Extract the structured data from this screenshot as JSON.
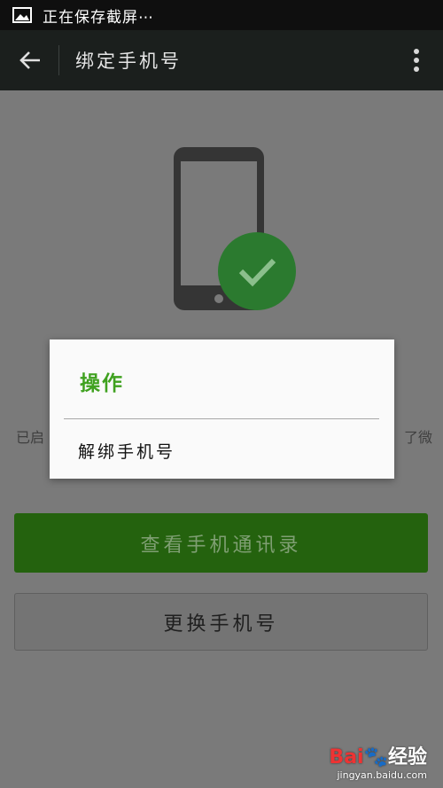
{
  "status_bar": {
    "text": "正在保存截屏⋯",
    "icon": "image-icon"
  },
  "title_bar": {
    "title": "绑定手机号",
    "back_icon": "back-arrow-icon",
    "menu_icon": "more-vert-icon"
  },
  "main": {
    "illustration": "phone-check-icon",
    "bind_info_left": "已启",
    "bind_info_right": "了微",
    "primary_button": "查看手机通讯录",
    "secondary_button": "更换手机号"
  },
  "dialog": {
    "title": "操作",
    "items": [
      "解绑手机号"
    ]
  },
  "watermark": {
    "logo_prefix": "Bai",
    "logo_suffix": "经验",
    "url": "jingyan.baidu.com"
  },
  "colors": {
    "accent_green": "#3fa11f",
    "button_green": "#24620e",
    "check_green": "#2b7a2f",
    "title_bar": "#1b1f1d",
    "overlay_gray": "#7a7a7a"
  }
}
